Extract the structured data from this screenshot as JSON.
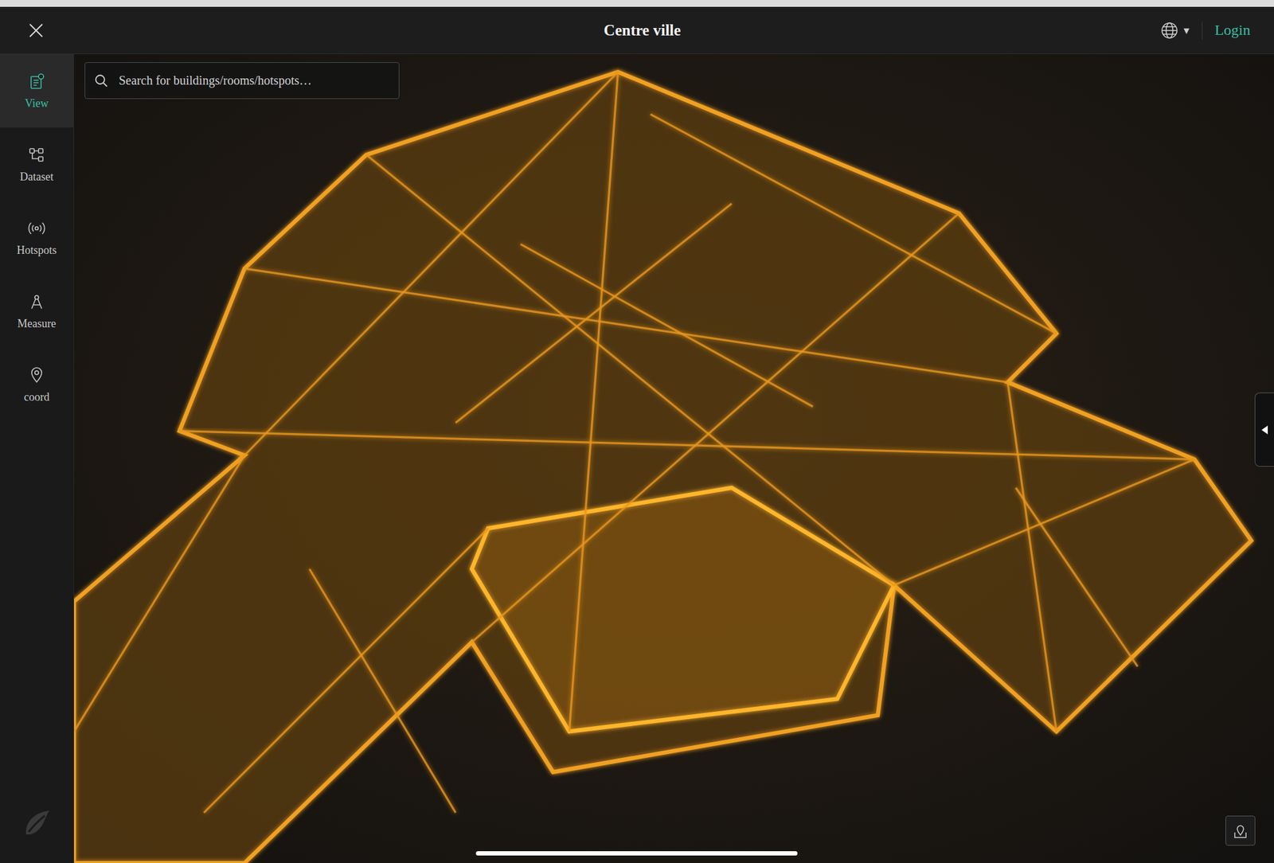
{
  "window": {
    "title": "Centre ville"
  },
  "header": {
    "language_caret": "▾",
    "login": "Login"
  },
  "search": {
    "placeholder": "Search for buildings/rooms/hotspots…"
  },
  "sidebar": {
    "items": [
      {
        "label": "View",
        "selected": true
      },
      {
        "label": "Dataset",
        "selected": false
      },
      {
        "label": "Hotspots",
        "selected": false
      },
      {
        "label": "Measure",
        "selected": false
      },
      {
        "label": "coord",
        "selected": false
      }
    ]
  }
}
